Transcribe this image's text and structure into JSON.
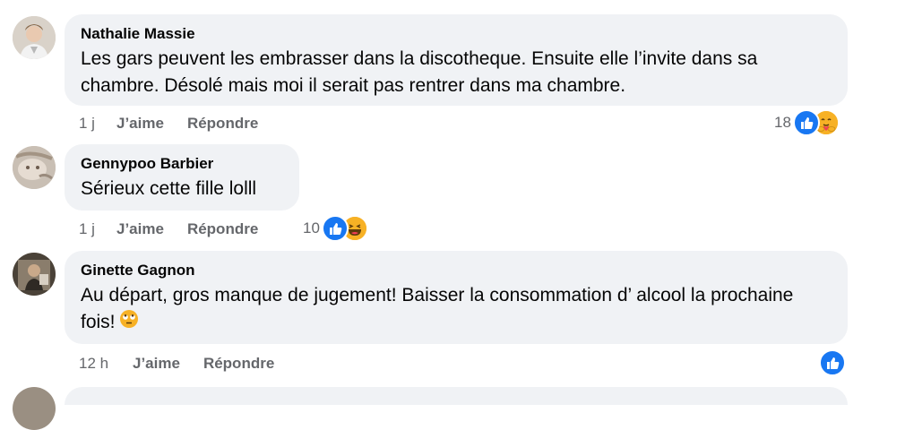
{
  "comments": [
    {
      "author": "Nathalie Massie",
      "text": "Les gars peuvent les embrasser dans la discotheque. Ensuite elle l’invite dans sa chambre. Désolé mais moi il serait pas rentrer dans ma chambre.",
      "time": "1 j",
      "like_label": "J’aime",
      "reply_label": "Répondre",
      "reaction_count": "18",
      "reactions": [
        "like-icon",
        "care-icon"
      ]
    },
    {
      "author": "Gennypoo Barbier",
      "text": "Sérieux cette fille lolll",
      "time": "1 j",
      "like_label": "J’aime",
      "reply_label": "Répondre",
      "reaction_count": "10",
      "reactions": [
        "like-icon",
        "haha-icon"
      ]
    },
    {
      "author": "Ginette Gagnon",
      "text": "Au départ, gros manque de jugement! Baisser la consommation d’ alcool la prochaine fois!",
      "inline_emoji": "face-with-rolling-eyes-icon",
      "time": "12 h",
      "like_label": "J’aime",
      "reply_label": "Répondre",
      "reactions": [
        "like-icon"
      ]
    }
  ],
  "colors": {
    "bubble": "#f0f2f5",
    "secondary_text": "#65676b",
    "like_blue": "#1877f2",
    "emoji_yellow": "#f7b125"
  }
}
